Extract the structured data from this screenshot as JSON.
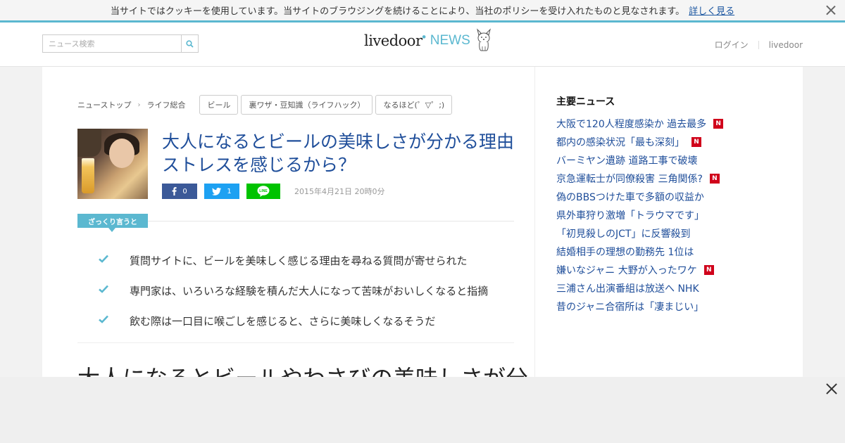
{
  "cookie_bar": {
    "text": "当サイトではクッキーを使用しています。当サイトのブラウジングを続けることにより、当社のポリシーを受け入れたものと見なされます。",
    "link_label": "詳しく見る"
  },
  "header": {
    "search_placeholder": "ニュース検索",
    "logo_livedoor": "livedoor",
    "logo_news": "NEWS",
    "login_label": "ログイン",
    "livedoor_link": "livedoor"
  },
  "breadcrumb": {
    "items": [
      "ニューストップ",
      "ライフ総合"
    ],
    "separator": "›"
  },
  "tags": [
    "ビール",
    "裏ワザ・豆知識（ライフハック）",
    "なるほど(゜▽゜;)"
  ],
  "article": {
    "title": "大人になるとビールの美味しさが分かる理由 ストレスを感じるから？",
    "share": {
      "facebook_count": "0",
      "twitter_count": "1"
    },
    "date": "2015年4月21日 20時0分",
    "summary_label": "ざっくり言うと",
    "points": [
      "質問サイトに、ビールを美味しく感じる理由を尋ねる質問が寄せられた",
      "専門家は、いろいろな経験を積んだ大人になって苦味がおいしくなると指摘",
      "飲む際は一口目に喉ごしを感じると、さらに美味しくなるそうだ"
    ],
    "body_heading": "大人になるとビールやわさびの美味しさが分"
  },
  "sidebar": {
    "title": "主要ニュース",
    "items": [
      {
        "text": "大阪で120人程度感染か 過去最多",
        "new": true
      },
      {
        "text": "都内の感染状況「最も深刻」",
        "new": true
      },
      {
        "text": "バーミヤン遺跡 道路工事で破壊",
        "new": false
      },
      {
        "text": "京急運転士が同僚殺害 三角関係?",
        "new": true
      },
      {
        "text": "偽のBBSつけた車で多額の収益か",
        "new": false
      },
      {
        "text": "県外車狩り激増「トラウマです」",
        "new": false
      },
      {
        "text": "「初見殺しのJCT」に反響殺到",
        "new": false
      },
      {
        "text": "結婚相手の理想の勤務先 1位は",
        "new": false
      },
      {
        "text": "嫌いなジャニ 大野が入ったワケ",
        "new": true
      },
      {
        "text": "三浦さん出演番組は放送へ NHK",
        "new": false
      },
      {
        "text": "昔のジャニ合宿所は「凄まじい」",
        "new": false
      }
    ],
    "new_badge": "N"
  },
  "colors": {
    "accent": "#5bb8d0",
    "link": "#1f4e9a",
    "badge": "#d0021b",
    "facebook": "#3b5998",
    "twitter": "#1da1f2",
    "line": "#00c300"
  }
}
